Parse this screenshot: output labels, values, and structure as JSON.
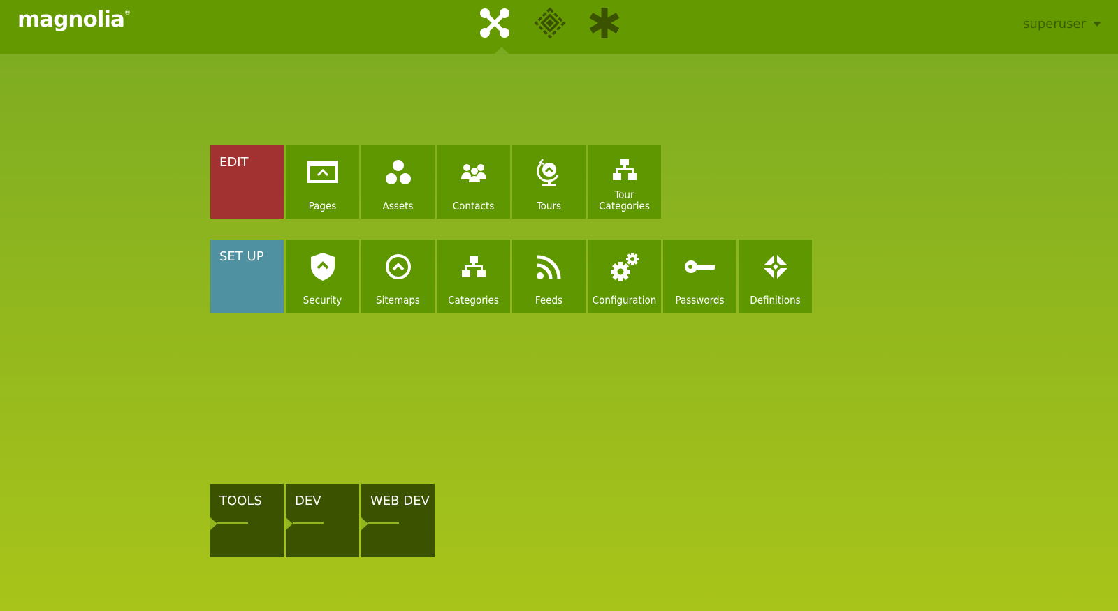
{
  "header": {
    "logo_text": "magnolia",
    "logo_mark": "®",
    "user": "superuser",
    "app_switcher": [
      {
        "name": "apps-icon",
        "active": true
      },
      {
        "name": "pulse-icon",
        "active": false
      },
      {
        "name": "favorites-icon",
        "active": false
      }
    ]
  },
  "edit": {
    "title": "EDIT",
    "apps": [
      {
        "label": "Pages",
        "icon": "pages-icon"
      },
      {
        "label": "Assets",
        "icon": "assets-icon"
      },
      {
        "label": "Contacts",
        "icon": "contacts-icon"
      },
      {
        "label": "Tours",
        "icon": "tours-icon"
      },
      {
        "label": "Tour Categories",
        "label_lines": [
          "Tour",
          "Categories"
        ],
        "icon": "tour-categories-icon"
      }
    ]
  },
  "setup": {
    "title": "SET UP",
    "apps": [
      {
        "label": "Security",
        "icon": "security-icon"
      },
      {
        "label": "Sitemaps",
        "icon": "sitemaps-icon"
      },
      {
        "label": "Categories",
        "icon": "categories-icon"
      },
      {
        "label": "Feeds",
        "icon": "feeds-icon"
      },
      {
        "label": "Configuration",
        "icon": "configuration-icon"
      },
      {
        "label": "Passwords",
        "icon": "passwords-icon"
      },
      {
        "label": "Definitions",
        "icon": "definitions-icon"
      }
    ]
  },
  "collapsed_groups": [
    {
      "title": "TOOLS"
    },
    {
      "title": "DEV"
    },
    {
      "title": "WEB DEV"
    }
  ],
  "colors": {
    "header_bg": "#649a00",
    "app_tile": "#5f9700",
    "edit_group": "#a23232",
    "setup_group": "#4f91a0",
    "collapsed_group": "#3b5200"
  }
}
